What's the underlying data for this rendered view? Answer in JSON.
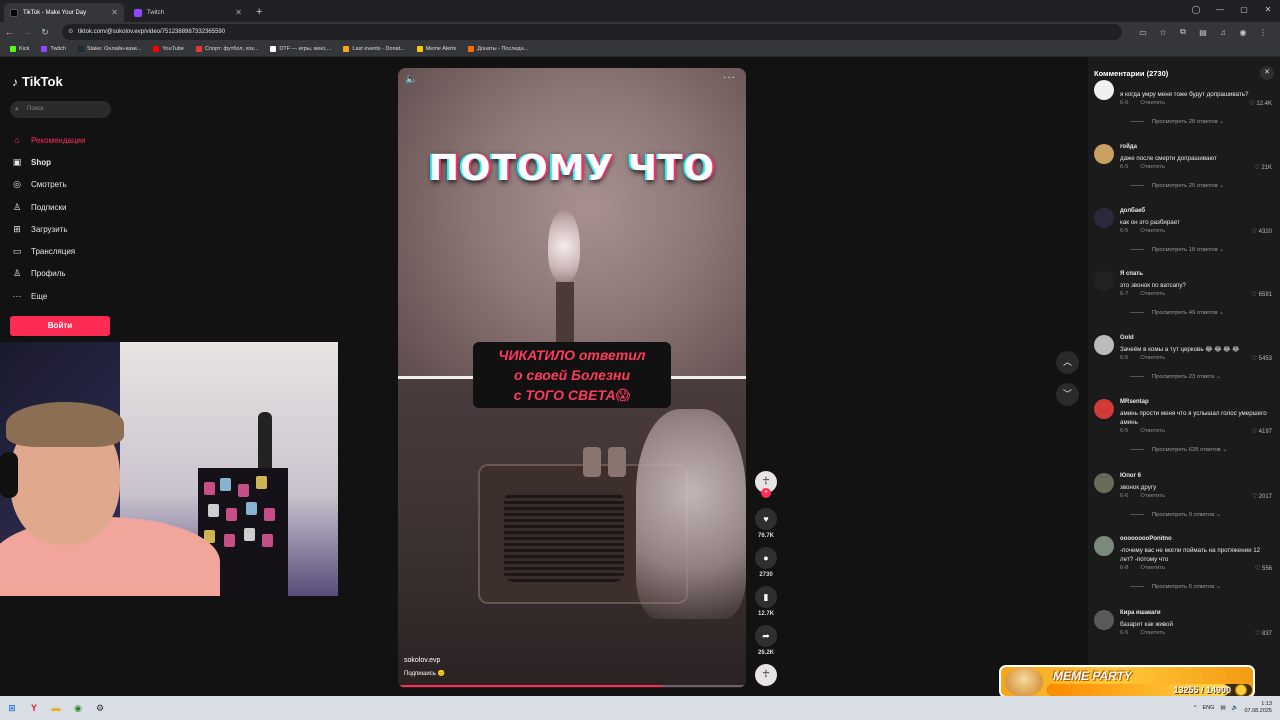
{
  "browser": {
    "tabs": [
      {
        "title": "TikTok - Make Your Day",
        "active": true,
        "color": "#000000"
      },
      {
        "title": "Twitch",
        "active": false,
        "color": "#9146ff"
      }
    ],
    "new_tab": "+",
    "url": "tiktok.com/@sokolov.evp/video/7512388987332365590",
    "bookmarks": [
      {
        "label": "Kick",
        "color": "#53fc18"
      },
      {
        "label": "Twitch",
        "color": "#9146ff"
      },
      {
        "label": "Stake: Онлайн-кази...",
        "color": "#1a2c38"
      },
      {
        "label": "YouTube",
        "color": "#ff0000"
      },
      {
        "label": "Спорт: футбол, хок...",
        "color": "#e53935"
      },
      {
        "label": "DTF — игры, кино,...",
        "color": "#ffffff"
      },
      {
        "label": "Last events - Donat...",
        "color": "#f6a623"
      },
      {
        "label": "Meme Alerts",
        "color": "#f9c800"
      },
      {
        "label": "Донаты - Последн...",
        "color": "#ff6b00"
      }
    ]
  },
  "sidebar": {
    "logo": "TikTok",
    "search_placeholder": "Поиск",
    "items": [
      {
        "label": "Рекомендации",
        "icon": "home-icon",
        "active": true
      },
      {
        "label": "Shop",
        "icon": "shop-icon",
        "active": false
      },
      {
        "label": "Смотреть",
        "icon": "explore-icon",
        "active": false
      },
      {
        "label": "Подписки",
        "icon": "following-icon",
        "active": false
      },
      {
        "label": "Загрузить",
        "icon": "upload-icon",
        "active": false
      },
      {
        "label": "Трансляция",
        "icon": "live-icon",
        "active": false
      },
      {
        "label": "Профиль",
        "icon": "profile-icon",
        "active": false
      },
      {
        "label": "Еще",
        "icon": "more-icon",
        "active": false
      }
    ],
    "login_label": "Войти",
    "accent": "#fe2c55"
  },
  "video": {
    "caption_top": "ПОТОМУ ЧТО",
    "caption_lines": [
      "ЧИКАТИЛО ответил",
      "о своей Болезни",
      "с ТОГО СВЕТА😱"
    ],
    "author": "sokolov.evp",
    "subscribe": "Подпишись 🙂",
    "progress": 0.76
  },
  "actions": {
    "likes": "76.7K",
    "comments": "2730",
    "saves": "12.7K",
    "shares": "26.2K"
  },
  "comments": {
    "header": "Комментарии (2730)",
    "reply_label": "Ответить",
    "items": [
      {
        "name": "",
        "text": "я когда умру меня тоже будут допрашивать?",
        "date": "6-6",
        "likes": "12.4K",
        "more": "Просмотреть 28 ответов",
        "avatar": "#f0f0f0"
      },
      {
        "name": "гойда",
        "text": "даже после смерти допрашивают",
        "date": "6-5",
        "likes": "21K",
        "more": "Просмотреть 25 ответов",
        "avatar": "#c8a060"
      },
      {
        "name": "долбаеб",
        "text": "как он это разбирает",
        "date": "6-5",
        "likes": "4320",
        "more": "Просмотреть 18 ответов",
        "avatar": "#2a2a3a"
      },
      {
        "name": "Я спать",
        "text": "это звонок по ватсапу?",
        "date": "6-7",
        "likes": "6591",
        "more": "Просмотреть 49 ответов",
        "avatar": "#222222"
      },
      {
        "name": "Gold",
        "text": "Зачеём в комы а тут церковь 😂 😂 😂 😂",
        "date": "6-5",
        "likes": "5453",
        "more": "Просмотреть 23 ответа",
        "avatar": "#bbbbbb"
      },
      {
        "name": "MRsentap",
        "text": "аминь прости меня что я услышал голос умершего аминь",
        "date": "6-5",
        "likes": "4197",
        "more": "Просмотреть 628 ответов",
        "avatar": "#d23a3a"
      },
      {
        "name": "Юпог 6",
        "text": "звонок другу",
        "date": "6-6",
        "likes": "2017",
        "more": "Просмотреть 9 ответов",
        "avatar": "#6a6a5a"
      },
      {
        "name": "ooooooooPonitno",
        "text": "-почему вас не могли поймать на протяжении 12 лет? -потому что",
        "date": "6-8",
        "likes": "556",
        "more": "Просмотреть 6 ответов",
        "avatar": "#7a8a7a"
      },
      {
        "name": "Кира ишакаги",
        "text": "базарит как живой",
        "date": "6-5",
        "likes": "837",
        "more": "",
        "avatar": "#5a5a5a"
      }
    ]
  },
  "meme_party": {
    "title": "MEME PARTY",
    "count": "13255 / 14900",
    "progress": 0.89
  },
  "taskbar": {
    "lang": "ENG",
    "time": "1:13",
    "date": "07.08.2025"
  }
}
